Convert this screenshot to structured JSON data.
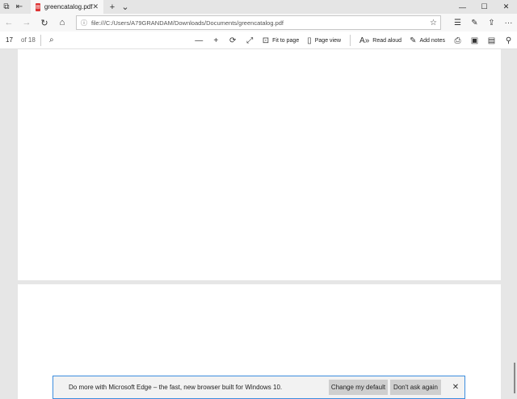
{
  "tabbar": {
    "tab_title": "greencatalog.pdf",
    "icons": [
      "tab-actions-icon",
      "tab-aside-icon",
      "pdf-icon",
      "close-icon",
      "plus-icon",
      "chevron-down-icon"
    ]
  },
  "window_controls": {
    "minimize": "—",
    "maximize": "☐",
    "close": "✕"
  },
  "addressbar": {
    "url": "file:///C:/Users/A79GRANDAM/Downloads/Documents/greencatalog.pdf",
    "icons": [
      "back-icon",
      "forward-icon",
      "refresh-icon",
      "home-icon",
      "info-icon",
      "star-icon",
      "favorites-icon",
      "pen-icon",
      "share-icon",
      "more-icon"
    ]
  },
  "pdf_toolbar": {
    "page_number": "17",
    "page_total": "of 18",
    "fit_to_page": "Fit to page",
    "page_view": "Page view",
    "read_aloud": "Read aloud",
    "add_notes": "Add notes"
  },
  "notification": {
    "message": "Do more with Microsoft Edge – the fast, new browser built for Windows 10.",
    "primary_button": "Change my default",
    "secondary_button": "Don't ask again"
  },
  "colors": {
    "accent": "#3c8dde",
    "tab_bg": "#e5e5e5",
    "page_bg": "#e6e6e6"
  }
}
